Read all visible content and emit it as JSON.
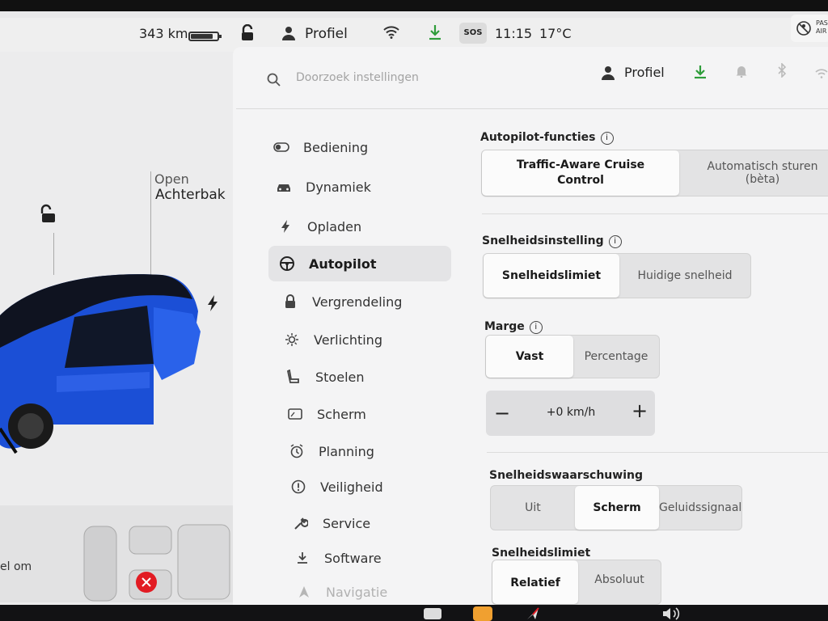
{
  "status_bar": {
    "range": "343 km",
    "battery_level": 0.85,
    "profile": "Profiel",
    "sos": "SOS",
    "time": "11:15",
    "temperature": "17°C",
    "passenger_airbag": "PASS AIR"
  },
  "car_panel": {
    "trunk_state": "Open",
    "trunk_label": "Achterbak",
    "bottom_text": "el om"
  },
  "settings_header": {
    "search_placeholder": "Doorzoek instellingen",
    "profile": "Profiel"
  },
  "nav": {
    "items": [
      {
        "label": "Bediening",
        "icon": "toggle-icon"
      },
      {
        "label": "Dynamiek",
        "icon": "car-icon"
      },
      {
        "label": "Opladen",
        "icon": "bolt-icon"
      },
      {
        "label": "Autopilot",
        "icon": "steering-wheel-icon"
      },
      {
        "label": "Vergrendeling",
        "icon": "lock-icon"
      },
      {
        "label": "Verlichting",
        "icon": "sun-icon"
      },
      {
        "label": "Stoelen",
        "icon": "seat-icon"
      },
      {
        "label": "Scherm",
        "icon": "screen-icon"
      },
      {
        "label": "Planning",
        "icon": "alarm-clock-icon"
      },
      {
        "label": "Veiligheid",
        "icon": "alert-circle-icon"
      },
      {
        "label": "Service",
        "icon": "wrench-icon"
      },
      {
        "label": "Software",
        "icon": "download-icon"
      },
      {
        "label": "Navigatie",
        "icon": "navigation-icon"
      }
    ],
    "active": "Autopilot"
  },
  "autopilot": {
    "functions": {
      "title": "Autopilot-functies",
      "options": [
        "Traffic-Aware Cruise Control",
        "Automatisch sturen (bèta)"
      ],
      "selected": "Traffic-Aware Cruise Control"
    },
    "speed_setting": {
      "title": "Snelheidsinstelling",
      "options": [
        "Snelheidslimiet",
        "Huidige snelheid"
      ],
      "selected": "Snelheidslimiet"
    },
    "margin": {
      "title": "Marge",
      "options": [
        "Vast",
        "Percentage"
      ],
      "selected": "Vast",
      "value": "+0 km/h",
      "decrease": "−",
      "increase": "+"
    },
    "speed_warning": {
      "title": "Snelheidswaarschuwing",
      "options": [
        "Uit",
        "Scherm",
        "Geluidssignaal"
      ],
      "selected": "Scherm"
    },
    "speed_limit": {
      "title": "Snelheidslimiet",
      "options": [
        "Relatief",
        "Absoluut"
      ],
      "selected": "Relatief"
    }
  },
  "colors": {
    "download_green": "#2e9d3a",
    "car_blue": "#1b4fd6",
    "alert_red": "#e21b23"
  }
}
